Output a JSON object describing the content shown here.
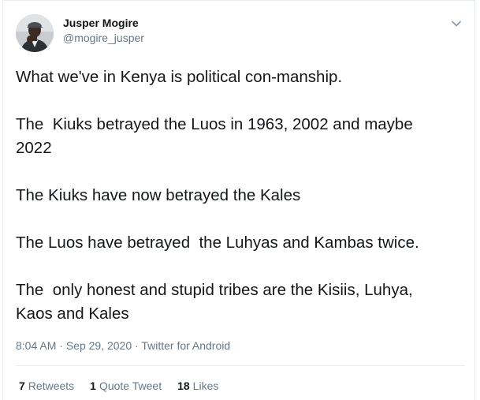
{
  "author": {
    "display_name": "Jusper Mogire",
    "handle": "@mogire_jusper"
  },
  "tweet": {
    "lines": [
      "What we've in Kenya is political con-manship.",
      "",
      "The  Kiuks betrayed the Luos in 1963, 2002 and maybe 2022",
      "",
      "The Kiuks have now betrayed the Kales",
      "",
      "The Luos have betrayed  the Luhyas and Kambas twice.",
      "",
      "The  only honest and stupid tribes are the Kisiis, Luhya, Kaos and Kales"
    ],
    "text": "What we've in Kenya is political con-manship.\n\nThe  Kiuks betrayed the Luos in 1963, 2002 and maybe\n2022\n\nThe Kiuks have now betrayed the Kales\n\nThe Luos have betrayed  the Luhyas and Kambas twice.\n\nThe  only honest and stupid tribes are the Kisiis, Luhya,\nKaos and Kales"
  },
  "meta": {
    "time": "8:04 AM",
    "separator": "·",
    "date": "Sep 29, 2020",
    "source": "Twitter for Android"
  },
  "stats": {
    "retweets_count": "7",
    "retweets_label": "Retweets",
    "quotes_count": "1",
    "quotes_label": "Quote Tweet",
    "likes_count": "18",
    "likes_label": "Likes"
  },
  "icons": {
    "menu": "chevron-down-icon"
  },
  "colors": {
    "text": "#14171a",
    "secondary": "#657786",
    "border": "#e6ecf0"
  }
}
